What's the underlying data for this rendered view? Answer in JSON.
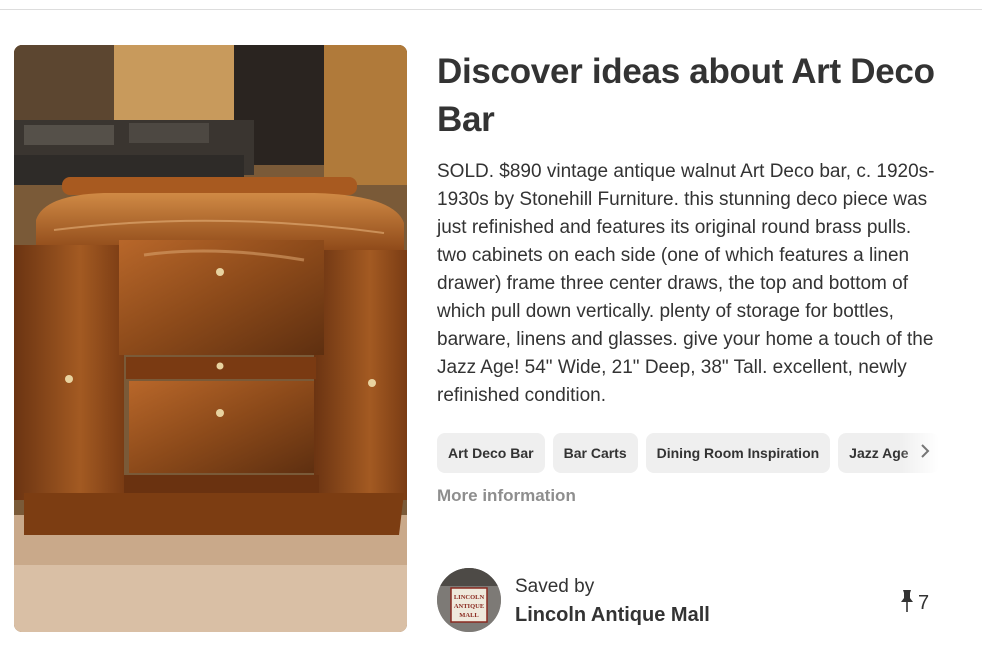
{
  "pin": {
    "image_alt": "Art Deco walnut bar",
    "title": "Discover ideas about Art Deco Bar",
    "description": "SOLD. $890 vintage antique walnut Art Deco bar, c. 1920s-1930s by Stonehill Furniture. this stunning deco piece was just refinished and features its original round brass pulls. two cabinets on each side (one of which features a linen drawer) frame three center draws, the top and bottom of which pull down vertically. plenty of storage for bottles, barware, linens and glasses. give your home a touch of the Jazz Age! 54\" Wide, 21\" Deep, 38\" Tall. excellent, newly refinished condition.",
    "tags": [
      {
        "label": "Art Deco Bar"
      },
      {
        "label": "Bar Carts"
      },
      {
        "label": "Dining Room Inspiration"
      },
      {
        "label": "Jazz Age"
      }
    ],
    "more_info_label": "More information",
    "saved_by_label": "Saved by",
    "saver_name": "Lincoln Antique Mall",
    "avatar_text": [
      "LINCOLN",
      "ANTIQUE",
      "MALL"
    ],
    "repin_count": "7",
    "icons": {
      "tag_next": "chevron-right-icon",
      "repin": "pushpin-icon"
    },
    "colors": {
      "text": "#333333",
      "muted": "#8e8e8e",
      "tag_bg": "#efefef"
    }
  }
}
